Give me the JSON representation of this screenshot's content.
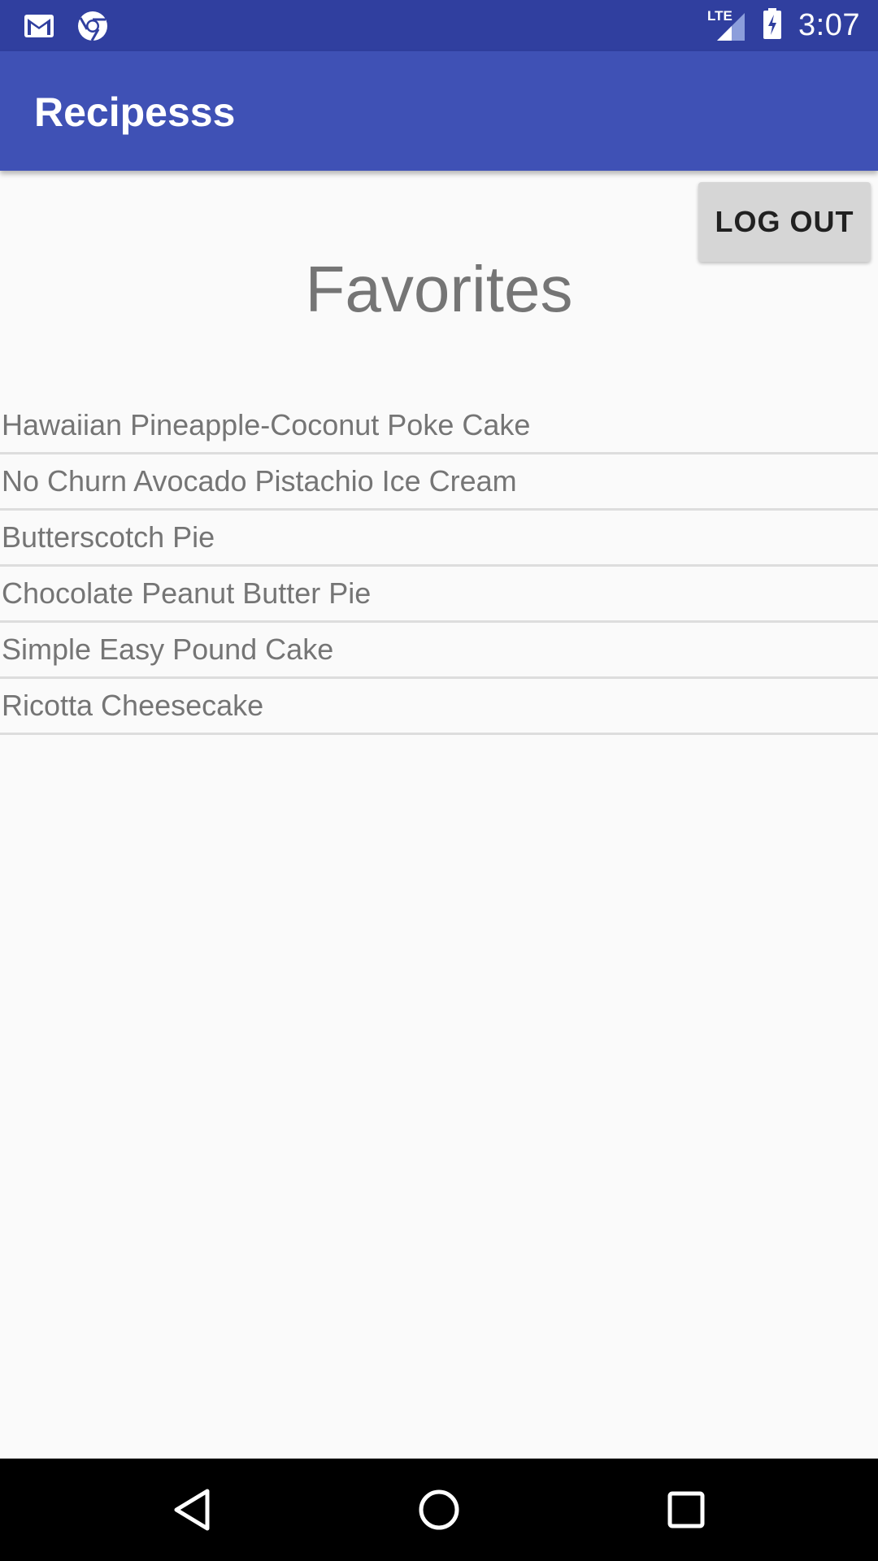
{
  "status_bar": {
    "time": "3:07",
    "network_label": "LTE",
    "icons": [
      "gmail-icon",
      "chrome-icon",
      "lte-signal-icon",
      "battery-charging-icon"
    ]
  },
  "app_bar": {
    "title": "Recipesss",
    "color": "#3F51B5"
  },
  "actions": {
    "logout_label": "LOG OUT"
  },
  "page": {
    "title": "Favorites"
  },
  "favorites": [
    "Hawaiian Pineapple-Coconut Poke Cake",
    "No Churn Avocado Pistachio Ice Cream",
    "Butterscotch Pie",
    "Chocolate Peanut Butter Pie",
    "Simple Easy Pound Cake",
    "Ricotta Cheesecake"
  ],
  "nav_bar": {
    "icons": [
      "back-icon",
      "home-icon",
      "recents-icon"
    ]
  },
  "colors": {
    "status_bar": "#303F9F",
    "app_bar": "#3F51B5",
    "background": "#FAFAFA",
    "text_secondary": "#757575"
  }
}
